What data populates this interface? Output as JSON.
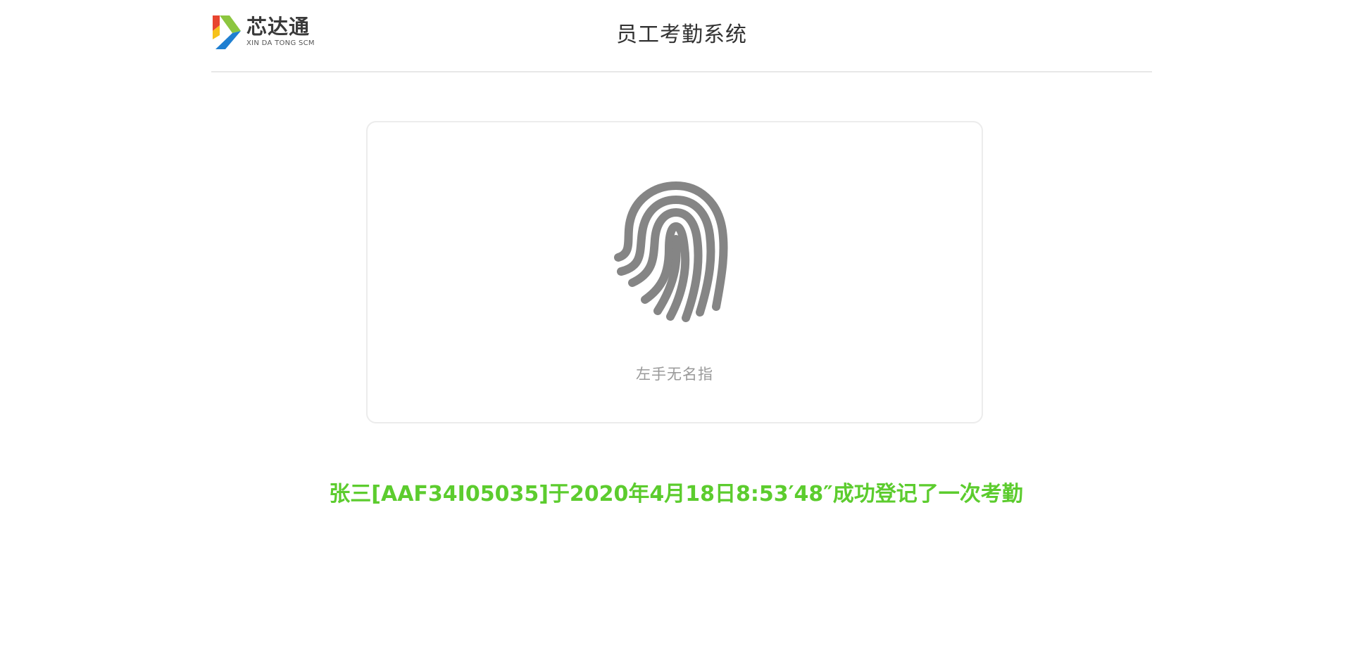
{
  "header": {
    "logo": {
      "name": "芯达通",
      "subtitle": "XIN DA TONG SCM",
      "colors": {
        "red": "#e8452f",
        "yellow": "#f6c21b",
        "green": "#8cc63f",
        "blue": "#1f7fd1"
      }
    },
    "title": "员工考勤系统"
  },
  "scanner": {
    "icon": "fingerprint-icon",
    "icon_color": "#858585",
    "finger_label": "左手无名指"
  },
  "result": {
    "message": "张三[AAF34I05035]于2020年4月18日8:53′48″成功登记了一次考勤",
    "color": "#5ccc2e"
  }
}
